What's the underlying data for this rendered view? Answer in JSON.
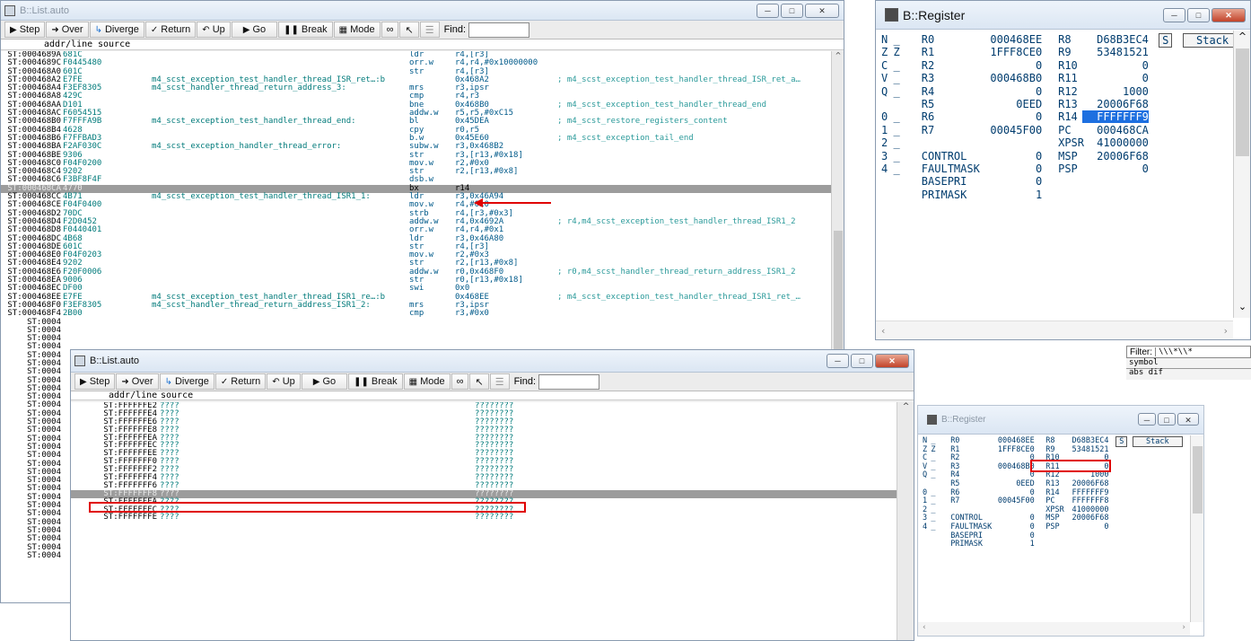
{
  "toolbar": {
    "step": "Step",
    "over": "Over",
    "diverge": "Diverge",
    "return": "Return",
    "up": "Up",
    "go": "Go",
    "break": "Break",
    "mode": "Mode",
    "find": "Find:"
  },
  "list1": {
    "title": "B::List.auto",
    "hdr_addr": "addr/line",
    "hdr_source": "source",
    "rows": [
      {
        "a": "ST:0004689A",
        "h": "681C",
        "l": "",
        "m": "ldr",
        "o": "r4,[r3]",
        "c": ""
      },
      {
        "a": "ST:0004689C",
        "h": "F0445480",
        "l": "",
        "m": "orr.w",
        "o": "r4,r4,#0x10000000",
        "c": ""
      },
      {
        "a": "ST:000468A0",
        "h": "601C",
        "l": "",
        "m": "str",
        "o": "r4,[r3]",
        "c": ""
      },
      {
        "a": "ST:000468A2",
        "h": "E7FE",
        "l": "m4_scst_exception_test_handler_thread_ISR_ret…:b",
        "m": "",
        "o": "0x468A2",
        "c": "; m4_scst_exception_test_handler_thread_ISR_ret_a…"
      },
      {
        "a": "ST:000468A4",
        "h": "F3EF8305",
        "l": "m4_scst_handler_thread_return_address_3:",
        "m": "mrs",
        "o": "r3,ipsr",
        "c": ""
      },
      {
        "a": "ST:000468A8",
        "h": "429C",
        "l": "",
        "m": "cmp",
        "o": "r4,r3",
        "c": ""
      },
      {
        "a": "ST:000468AA",
        "h": "D101",
        "l": "",
        "m": "bne",
        "o": "0x468B0",
        "c": "; m4_scst_exception_test_handler_thread_end"
      },
      {
        "a": "ST:000468AC",
        "h": "F6054515",
        "l": "",
        "m": "addw.w",
        "o": "r5,r5,#0xC15",
        "c": ""
      },
      {
        "a": "ST:000468B0",
        "h": "F7FFFA9B",
        "l": "m4_scst_exception_test_handler_thread_end:",
        "m": "bl",
        "o": "0x45DEA",
        "c": "; m4_scst_restore_registers_content"
      },
      {
        "a": "ST:000468B4",
        "h": "4628",
        "l": "",
        "m": "cpy",
        "o": "r0,r5",
        "c": ""
      },
      {
        "a": "ST:000468B6",
        "h": "F7FFBAD3",
        "l": "",
        "m": "b.w",
        "o": "0x45E60",
        "c": "; m4_scst_exception_tail_end"
      },
      {
        "a": "ST:000468BA",
        "h": "F2AF030C",
        "l": "m4_scst_exception_handler_thread_error:",
        "m": "subw.w",
        "o": "r3,0x468B2",
        "c": ""
      },
      {
        "a": "ST:000468BE",
        "h": "9306",
        "l": "",
        "m": "str",
        "o": "r3,[r13,#0x18]",
        "c": ""
      },
      {
        "a": "ST:000468C0",
        "h": "F04F0200",
        "l": "",
        "m": "mov.w",
        "o": "r2,#0x0",
        "c": ""
      },
      {
        "a": "ST:000468C4",
        "h": "9202",
        "l": "",
        "m": "str",
        "o": "r2,[r13,#0x8]",
        "c": ""
      },
      {
        "a": "ST:000468C6",
        "h": "F3BF8F4F",
        "l": "",
        "m": "dsb.w",
        "o": "",
        "c": ""
      },
      {
        "a": "ST:000468CA",
        "h": "4770",
        "l": "",
        "m": "bx",
        "o": "r14",
        "c": "",
        "cur": true
      },
      {
        "a": "ST:000468CC",
        "h": "4B71",
        "l": "m4_scst_exception_test_handler_thread_ISR1_1:",
        "m": "ldr",
        "o": "r3,0x46A94",
        "c": ""
      },
      {
        "a": "ST:000468CE",
        "h": "F04F0400",
        "l": "",
        "m": "mov.w",
        "o": "r4,#0x0",
        "c": ""
      },
      {
        "a": "ST:000468D2",
        "h": "70DC",
        "l": "",
        "m": "strb",
        "o": "r4,[r3,#0x3]",
        "c": ""
      },
      {
        "a": "ST:000468D4",
        "h": "F2D0452",
        "l": "",
        "m": "addw.w",
        "o": "r4,0x4692A",
        "c": "; r4,m4_scst_exception_test_handler_thread_ISR1_2"
      },
      {
        "a": "ST:000468D8",
        "h": "F0440401",
        "l": "",
        "m": "orr.w",
        "o": "r4,r4,#0x1",
        "c": ""
      },
      {
        "a": "ST:000468DC",
        "h": "4B68",
        "l": "",
        "m": "ldr",
        "o": "r3,0x46A80",
        "c": ""
      },
      {
        "a": "ST:000468DE",
        "h": "601C",
        "l": "",
        "m": "str",
        "o": "r4,[r3]",
        "c": ""
      },
      {
        "a": "ST:000468E0",
        "h": "F04F0203",
        "l": "",
        "m": "mov.w",
        "o": "r2,#0x3",
        "c": ""
      },
      {
        "a": "ST:000468E4",
        "h": "9202",
        "l": "",
        "m": "str",
        "o": "r2,[r13,#0x8]",
        "c": ""
      },
      {
        "a": "ST:000468E6",
        "h": "F20F0006",
        "l": "",
        "m": "addw.w",
        "o": "r0,0x468F0",
        "c": "; r0,m4_scst_handler_thread_return_address_ISR1_2"
      },
      {
        "a": "ST:000468EA",
        "h": "9006",
        "l": "",
        "m": "str",
        "o": "r0,[r13,#0x18]",
        "c": ""
      },
      {
        "a": "ST:000468EC",
        "h": "DF00",
        "l": "",
        "m": "swi",
        "o": "0x0",
        "c": ""
      },
      {
        "a": "ST:000468EE",
        "h": "E7FE",
        "l": "m4_scst_exception_test_handler_thread_ISR1_re…:b",
        "m": "",
        "o": "0x468EE",
        "c": "; m4_scst_exception_test_handler_thread_ISR1_ret_…"
      },
      {
        "a": "ST:000468F0",
        "h": "F3EF8305",
        "l": "m4_scst_handler_thread_return_address_ISR1_2:",
        "m": "mrs",
        "o": "r3,ipsr",
        "c": ""
      },
      {
        "a": "ST:000468F4",
        "h": "2B00",
        "l": "",
        "m": "cmp",
        "o": "r3,#0x0",
        "c": ""
      }
    ],
    "left_stub": [
      "ST:0004",
      "ST:0004",
      "ST:0004",
      "ST:0004",
      "ST:0004",
      "ST:0004",
      "ST:0004",
      "ST:0004",
      "ST:0004",
      "ST:0004",
      "ST:0004",
      "ST:0004",
      "ST:0004",
      "ST:0004",
      "ST:0004",
      "ST:0004",
      "ST:0004",
      "ST:0004",
      "ST:0004",
      "ST:0004",
      "ST:0004",
      "ST:0004",
      "ST:0004",
      "ST:0004",
      "ST:0004",
      "ST:0004",
      "ST:0004",
      "ST:0004",
      "ST:0004"
    ]
  },
  "list2": {
    "title": "B::List.auto",
    "hdr_addr": "addr/line",
    "hdr_source": "source",
    "rows": [
      {
        "a": "ST:FFFFFFE2",
        "h": "????",
        "v": "????????"
      },
      {
        "a": "ST:FFFFFFE4",
        "h": "????",
        "v": "????????"
      },
      {
        "a": "ST:FFFFFFE6",
        "h": "????",
        "v": "????????"
      },
      {
        "a": "ST:FFFFFFE8",
        "h": "????",
        "v": "????????"
      },
      {
        "a": "ST:FFFFFFEA",
        "h": "????",
        "v": "????????"
      },
      {
        "a": "ST:FFFFFFEC",
        "h": "????",
        "v": "????????"
      },
      {
        "a": "ST:FFFFFFEE",
        "h": "????",
        "v": "????????"
      },
      {
        "a": "ST:FFFFFFF0",
        "h": "????",
        "v": "????????"
      },
      {
        "a": "ST:FFFFFFF2",
        "h": "????",
        "v": "????????"
      },
      {
        "a": "ST:FFFFFFF4",
        "h": "????",
        "v": "????????"
      },
      {
        "a": "ST:FFFFFFF6",
        "h": "????",
        "v": "????????"
      },
      {
        "a": "ST:FFFFFFF8",
        "h": "????",
        "v": "????????",
        "cur": true
      },
      {
        "a": "ST:FFFFFFFA",
        "h": "????",
        "v": "????????"
      },
      {
        "a": "ST:FFFFFFFC",
        "h": "????",
        "v": "????????"
      },
      {
        "a": "ST:FFFFFFFE",
        "h": "????",
        "v": "????????"
      }
    ]
  },
  "register": {
    "title": "B::Register",
    "stack_btn": "Stack",
    "s_btn": "S",
    "flags": [
      [
        "N",
        "_"
      ],
      [
        "Z",
        "Z"
      ],
      [
        "C",
        "_"
      ],
      [
        "V",
        "_"
      ],
      [
        "Q",
        "_"
      ],
      [
        "",
        ""
      ],
      [
        "0",
        "_"
      ],
      [
        "1",
        "_"
      ],
      [
        "2",
        "_"
      ],
      [
        "3",
        "_"
      ],
      [
        "4",
        "_"
      ]
    ],
    "left": [
      [
        "R0",
        "000468EE"
      ],
      [
        "R1",
        "1FFF8CE0"
      ],
      [
        "R2",
        "0"
      ],
      [
        "R3",
        "000468B0"
      ],
      [
        "R4",
        "0"
      ],
      [
        "R5",
        "0EED"
      ],
      [
        "R6",
        "0"
      ],
      [
        "R7",
        "00045F00"
      ],
      [
        "",
        ""
      ],
      [
        "CONTROL",
        "0"
      ],
      [
        "FAULTMASK",
        "0"
      ],
      [
        "BASEPRI",
        "0"
      ],
      [
        "PRIMASK",
        "1"
      ]
    ],
    "right": [
      [
        "R8",
        "D68B3EC4"
      ],
      [
        "R9",
        "53481521"
      ],
      [
        "R10",
        "0"
      ],
      [
        "R11",
        "0"
      ],
      [
        "R12",
        "1000"
      ],
      [
        "R13",
        "20006F68"
      ],
      [
        "R14",
        "FFFFFFF9"
      ],
      [
        "PC",
        "000468CA"
      ],
      [
        "XPSR",
        "41000000"
      ],
      [
        "MSP",
        "20006F68"
      ],
      [
        "PSP",
        "0"
      ]
    ],
    "right2": [
      [
        "R8",
        "D68B3EC4"
      ],
      [
        "R9",
        "53481521"
      ],
      [
        "R10",
        "0"
      ],
      [
        "R11",
        "0"
      ],
      [
        "R12",
        "1000"
      ],
      [
        "R13",
        "20006F68"
      ],
      [
        "R14",
        "FFFFFFF9"
      ],
      [
        "PC",
        "FFFFFFF8"
      ],
      [
        "XPSR",
        "41000000"
      ],
      [
        "MSP",
        "20006F68"
      ],
      [
        "PSP",
        "0"
      ]
    ]
  },
  "filter": {
    "label": "Filter:",
    "value": "\\\\\\*\\\\*",
    "items": [
      "symbol",
      "abs dif"
    ]
  }
}
